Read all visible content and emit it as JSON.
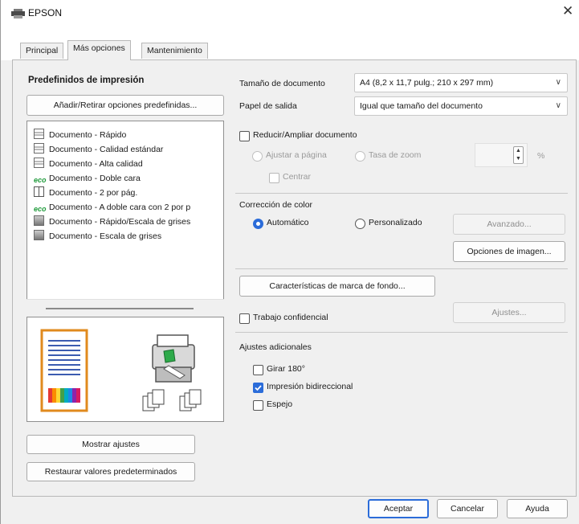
{
  "window": {
    "title": "EPSON",
    "close_glyph": "✕"
  },
  "tabs": [
    {
      "label": "Principal",
      "active": false
    },
    {
      "label": "Más opciones",
      "active": true
    },
    {
      "label": "Mantenimiento",
      "active": false
    }
  ],
  "presets": {
    "heading": "Predefinidos de impresión",
    "add_remove_button": "Añadir/Retirar opciones predefinidas...",
    "items": [
      {
        "icon": "document-icon",
        "label": "Documento - Rápido"
      },
      {
        "icon": "document-icon",
        "label": "Documento - Calidad estándar"
      },
      {
        "icon": "document-icon",
        "label": "Documento - Alta calidad"
      },
      {
        "icon": "eco-icon",
        "label": "Documento - Doble cara",
        "icon_text": "eco"
      },
      {
        "icon": "two-up-icon",
        "label": "Documento - 2 por pág."
      },
      {
        "icon": "eco-icon",
        "label": "Documento - A doble cara con 2 por p",
        "icon_text": "eco"
      },
      {
        "icon": "grayscale-document-icon",
        "label": "Documento - Rápido/Escala de grises"
      },
      {
        "icon": "grayscale-document-icon",
        "label": "Documento - Escala de grises"
      }
    ],
    "show_settings_button": "Mostrar ajustes",
    "restore_defaults_button": "Restaurar valores predeterminados"
  },
  "document": {
    "size_label": "Tamaño de documento",
    "size_value": "A4 (8,2 x 11,7 pulg.; 210 x 297 mm)",
    "output_label": "Papel de salida",
    "output_value": "Igual que tamaño del documento",
    "reduce_enlarge_label": "Reducir/Ampliar documento",
    "reduce_enlarge_checked": false,
    "fit_page_label": "Ajustar a página",
    "zoom_rate_label": "Tasa de zoom",
    "zoom_unit": "%",
    "zoom_value": "",
    "center_label": "Centrar"
  },
  "color_correction": {
    "label": "Corrección de color",
    "automatic_label": "Automático",
    "custom_label": "Personalizado",
    "selected": "automatic",
    "advanced_button": "Avanzado...",
    "image_options_button": "Opciones de imagen..."
  },
  "watermark_button": "Características de marca de fondo...",
  "confidential": {
    "label": "Trabajo confidencial",
    "checked": false,
    "settings_button": "Ajustes..."
  },
  "extra": {
    "label": "Ajustes adicionales",
    "rotate_label": "Girar 180°",
    "rotate_checked": false,
    "bidirectional_label": "Impresión bidireccional",
    "bidirectional_checked": true,
    "mirror_label": "Espejo",
    "mirror_checked": false
  },
  "footer": {
    "ok_button": "Aceptar",
    "cancel_button": "Cancelar",
    "help_button": "Ayuda"
  },
  "colors": {
    "accent": "#2b6cd9",
    "eco_green": "#1e9a3a"
  }
}
